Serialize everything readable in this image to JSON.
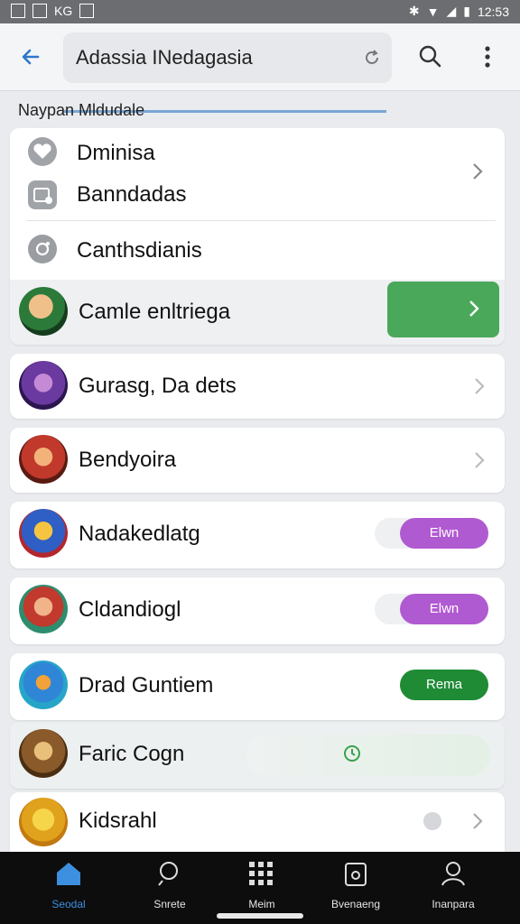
{
  "statusbar": {
    "left_text": "KG",
    "time": "12:53"
  },
  "header": {
    "search_value": "Adassia INedagasia"
  },
  "section_title": "Naypan Mldudale",
  "settings_card": {
    "items": [
      {
        "label": "Dminisa",
        "icon": "heart-icon"
      },
      {
        "label": "Banndadas",
        "icon": "media-icon"
      },
      {
        "label": "Canthsdianis",
        "icon": "camera-icon"
      }
    ]
  },
  "games": [
    {
      "label": "Camle enltriega",
      "icon": "game-avatar-icon",
      "action": "chevron",
      "highlight": true
    },
    {
      "label": "Gurasg, Da dets",
      "icon": "game-avatar-icon",
      "action": "chevron"
    },
    {
      "label": "Bendyoira",
      "icon": "game-avatar-icon",
      "action": "chevron"
    },
    {
      "label": "Nadakedlatg",
      "icon": "game-avatar-icon",
      "action": "pill",
      "pill": "Elwn",
      "pill_color": "#b05ad1"
    },
    {
      "label": "Cldandiogl",
      "icon": "game-avatar-icon",
      "action": "pill",
      "pill": "Elwn",
      "pill_color": "#b05ad1"
    },
    {
      "label": "Drad Guntiem",
      "icon": "game-avatar-icon",
      "action": "pill",
      "pill": "Rema",
      "pill_color": "#1f8b35"
    },
    {
      "label": "Faric Cogn",
      "icon": "game-avatar-icon",
      "action": "status"
    },
    {
      "label": "Kidsrahl",
      "icon": "game-avatar-icon",
      "action": "chevron-dot"
    }
  ],
  "bottom_nav": [
    {
      "label": "Seodal",
      "icon": "home-icon",
      "active": true
    },
    {
      "label": "Snrete",
      "icon": "search-icon"
    },
    {
      "label": "Meim",
      "icon": "grid-icon"
    },
    {
      "label": "Bvenaeng",
      "icon": "calendar-icon"
    },
    {
      "label": "Inanpara",
      "icon": "profile-icon"
    }
  ],
  "colors": {
    "accent": "#3d8fe0",
    "green": "#4aa85a",
    "purple": "#b05ad1",
    "dark_green": "#1f8b35"
  }
}
